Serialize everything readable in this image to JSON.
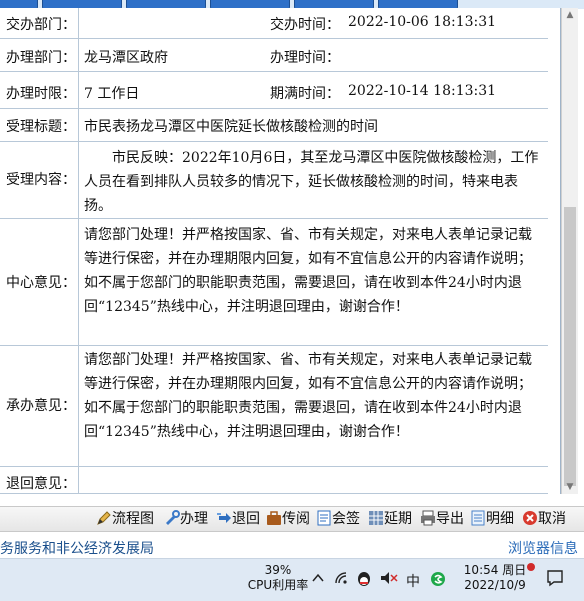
{
  "tabs": [
    "",
    "",
    "",
    "",
    "",
    ""
  ],
  "form": {
    "row1": {
      "label": "交办部门：",
      "value": "",
      "label2": "交办时间：",
      "value2": "2022-10-06 18:13:31"
    },
    "row2": {
      "label": "办理部门：",
      "value": "龙马潭区政府",
      "label2": "办理时间：",
      "value2": ""
    },
    "row3": {
      "label": "办理时限：",
      "value": "7 工作日",
      "label2": "期满时间：",
      "value2": "2022-10-14 18:13:31"
    },
    "title": {
      "label": "受理标题：",
      "value": "市民表扬龙马潭区中医院延长做核酸检测的时间"
    },
    "content": {
      "label": "受理内容：",
      "value": "市民反映：2022年10月6日，其至龙马潭区中医院做核酸检测，工作人员在看到排队人员较多的情况下，延长做核酸检测的时间，特来电表扬。"
    },
    "center_opinion": {
      "label": "中心意见：",
      "value": "请您部门处理！并严格按国家、省、市有关规定，对来电人表单记录记载等进行保密，并在办理期限内回复，如有不宜信息公开的内容请作说明；如不属于您部门的职能职责范围，需要退回，请在收到本件24小时内退回“12345”热线中心，并注明退回理由，谢谢合作！"
    },
    "undertake_opinion": {
      "label": "承办意见：",
      "value": "请您部门处理！并严格按国家、省、市有关规定，对来电人表单记录记载等进行保密，并在办理期限内回复，如有不宜信息公开的内容请作说明；如不属于您部门的职能职责范围，需要退回，请在收到本件24小时内退回“12345”热线中心，并注明退回理由，谢谢合作！"
    },
    "return_opinion": {
      "label": "退回意见：",
      "value": ""
    }
  },
  "toolbar": {
    "flowchart": "流程图",
    "handle": "办理",
    "return": "退回",
    "circulate": "传阅",
    "countersign": "会签",
    "extend": "延期",
    "export": "导出",
    "detail": "明细",
    "cancel": "取消"
  },
  "status": {
    "left": "务服务和非公经济发展局",
    "right": "浏览器信息"
  },
  "taskbar": {
    "cpu_percent": "39%",
    "cpu_label": "CPU利用率",
    "ime_label": "中",
    "time": "10:54 周日",
    "date": "2022/10/9"
  },
  "colors": {
    "tab_blue": "#2e70c8",
    "status_link": "#2a6bb8",
    "border": "#b8c8d8",
    "notification": "#d12b2b"
  }
}
